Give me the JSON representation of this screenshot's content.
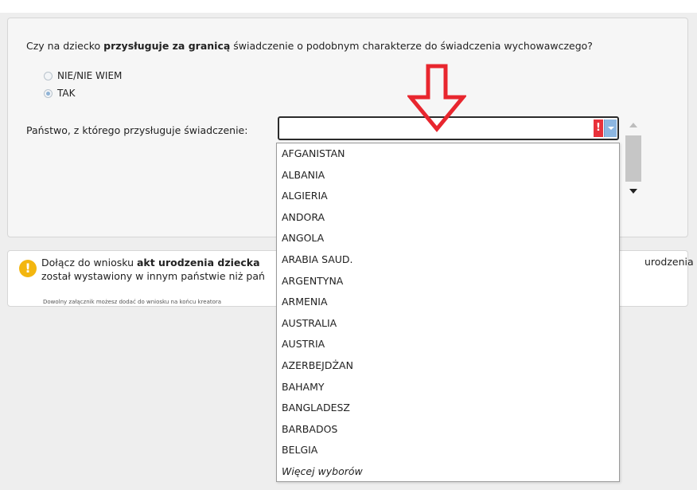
{
  "question": {
    "part1": "Czy na dziecko ",
    "bold": "przysługuje za granicą",
    "part2": " świadczenie o podobnym charakterze do świadczenia wychowawczego?"
  },
  "radios": [
    {
      "label": "NIE/NIE WIEM",
      "checked": false
    },
    {
      "label": "TAK",
      "checked": true
    }
  ],
  "country_field": {
    "label": "Państwo, z którego przysługuje świadczenie:",
    "value": "",
    "error_glyph": "!"
  },
  "dropdown": {
    "options": [
      "AFGANISTAN",
      "ALBANIA",
      "ALGIERIA",
      "ANDORA",
      "ANGOLA",
      "ARABIA SAUD.",
      "ARGENTYNA",
      "ARMENIA",
      "AUSTRALIA",
      "AUSTRIA",
      "AZERBEJDŻAN",
      "BAHAMY",
      "BANGLADESZ",
      "BARBADOS",
      "BELGIA"
    ],
    "more_label": "Więcej wyborów"
  },
  "info": {
    "icon_glyph": "!",
    "line1_part1": "Dołącz do wniosku ",
    "line1_bold": "akt urodzenia dziecka",
    "line1_right": "urodzenia",
    "line2": "został wystawiony w innym państwie niż pań",
    "small_note": "Dowolny załącznik możesz dodać do wniosku na końcu kreatora"
  },
  "colors": {
    "error_red": "#e8313a",
    "warning_yellow": "#f3b60f",
    "annotation_arrow": "#e8262e",
    "combo_arrow_blue": "#8db6e0"
  }
}
